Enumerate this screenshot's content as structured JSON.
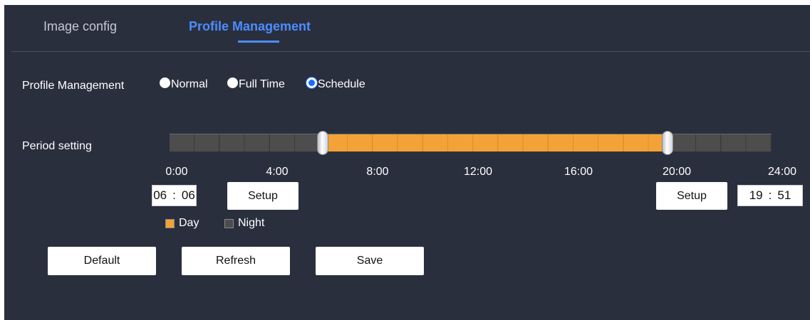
{
  "tabs": [
    {
      "label": "Image config",
      "active": false
    },
    {
      "label": "Profile Management",
      "active": true
    }
  ],
  "profile": {
    "label": "Profile Management",
    "options": [
      {
        "label": "Normal",
        "checked": false
      },
      {
        "label": "Full Time",
        "checked": false
      },
      {
        "label": "Schedule",
        "checked": true
      }
    ]
  },
  "period": {
    "label": "Period setting",
    "ticks": [
      "0:00",
      "4:00",
      "8:00",
      "12:00",
      "16:00",
      "20:00",
      "24:00"
    ],
    "day_start": {
      "hour": "06",
      "minute": "06",
      "sep": ":"
    },
    "day_end": {
      "hour": "19",
      "minute": "51",
      "sep": ":"
    },
    "setup_left": "Setup",
    "setup_right": "Setup"
  },
  "legend": {
    "day": "Day",
    "night": "Night",
    "day_color": "#f3a237",
    "night_color": "#4d4d4d"
  },
  "actions": {
    "default": "Default",
    "refresh": "Refresh",
    "save": "Save"
  },
  "colors": {
    "background": "#2a2f3e",
    "accent": "#4b8dff",
    "radio_checked": "#1a6cff"
  }
}
